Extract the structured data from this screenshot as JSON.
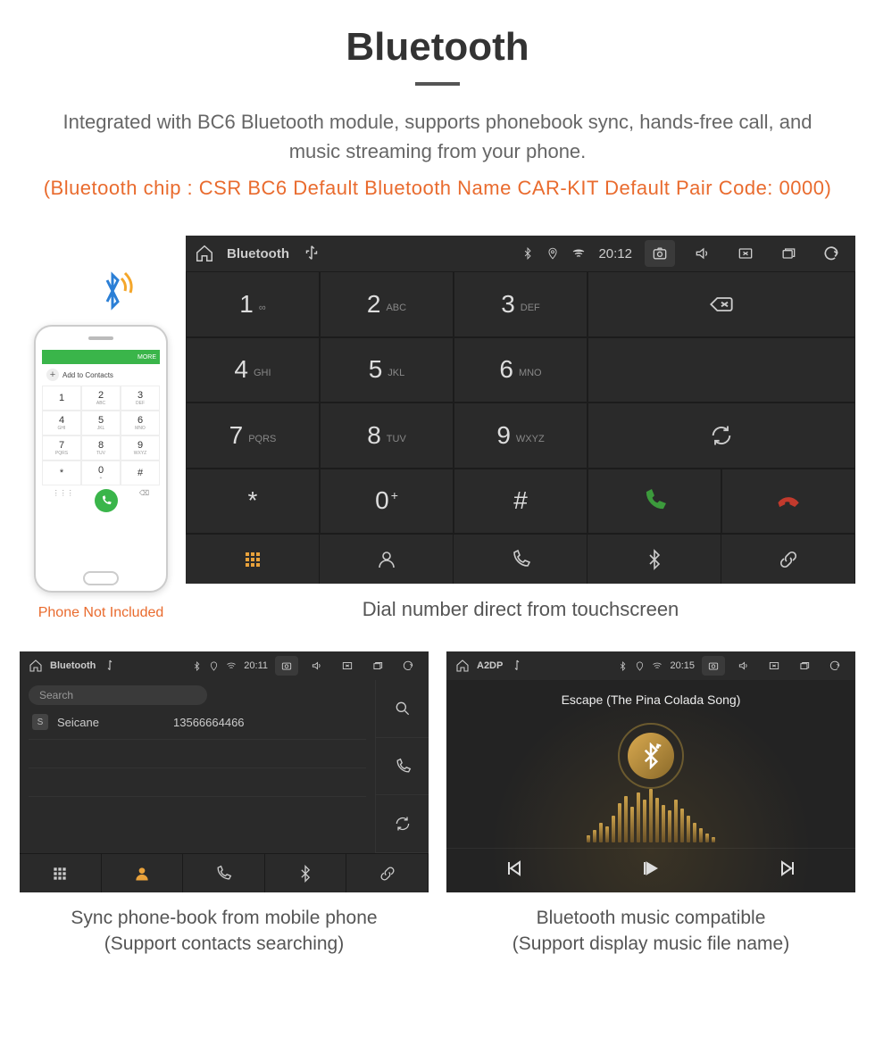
{
  "hero": {
    "title": "Bluetooth",
    "description": "Integrated with BC6 Bluetooth module, supports phonebook sync, hands-free call, and music streaming from your phone.",
    "specs": "(Bluetooth chip : CSR BC6     Default Bluetooth Name CAR-KIT     Default Pair Code: 0000)"
  },
  "phone_note": "Phone Not Included",
  "phone_mock": {
    "topbar": "MORE",
    "add_label": "Add to Contacts",
    "keys": [
      {
        "d": "1",
        "l": ""
      },
      {
        "d": "2",
        "l": "ABC"
      },
      {
        "d": "3",
        "l": "DEF"
      },
      {
        "d": "4",
        "l": "GHI"
      },
      {
        "d": "5",
        "l": "JKL"
      },
      {
        "d": "6",
        "l": "MNO"
      },
      {
        "d": "7",
        "l": "PQRS"
      },
      {
        "d": "8",
        "l": "TUV"
      },
      {
        "d": "9",
        "l": "WXYZ"
      },
      {
        "d": "*",
        "l": ""
      },
      {
        "d": "0",
        "l": "+"
      },
      {
        "d": "#",
        "l": ""
      }
    ]
  },
  "dialer": {
    "status": {
      "title": "Bluetooth",
      "time": "20:12"
    },
    "keys": [
      {
        "d": "1",
        "l": "∞"
      },
      {
        "d": "2",
        "l": "ABC"
      },
      {
        "d": "3",
        "l": "DEF"
      },
      {
        "d": "4",
        "l": "GHI"
      },
      {
        "d": "5",
        "l": "JKL"
      },
      {
        "d": "6",
        "l": "MNO"
      },
      {
        "d": "7",
        "l": "PQRS"
      },
      {
        "d": "8",
        "l": "TUV"
      },
      {
        "d": "9",
        "l": "WXYZ"
      },
      {
        "d": "*",
        "l": ""
      },
      {
        "d": "0",
        "l": "+",
        "sup": true
      },
      {
        "d": "#",
        "l": ""
      }
    ],
    "caption": "Dial number direct from touchscreen"
  },
  "contacts": {
    "status": {
      "title": "Bluetooth",
      "time": "20:11"
    },
    "search_placeholder": "Search",
    "rows": [
      {
        "initial": "S",
        "name": "Seicane",
        "number": "13566664466"
      }
    ],
    "caption_line1": "Sync phone-book from mobile phone",
    "caption_line2": "(Support contacts searching)"
  },
  "music": {
    "status": {
      "title": "A2DP",
      "time": "20:15"
    },
    "track": "Escape (The Pina Colada Song)",
    "caption_line1": "Bluetooth music compatible",
    "caption_line2": "(Support display music file name)"
  }
}
